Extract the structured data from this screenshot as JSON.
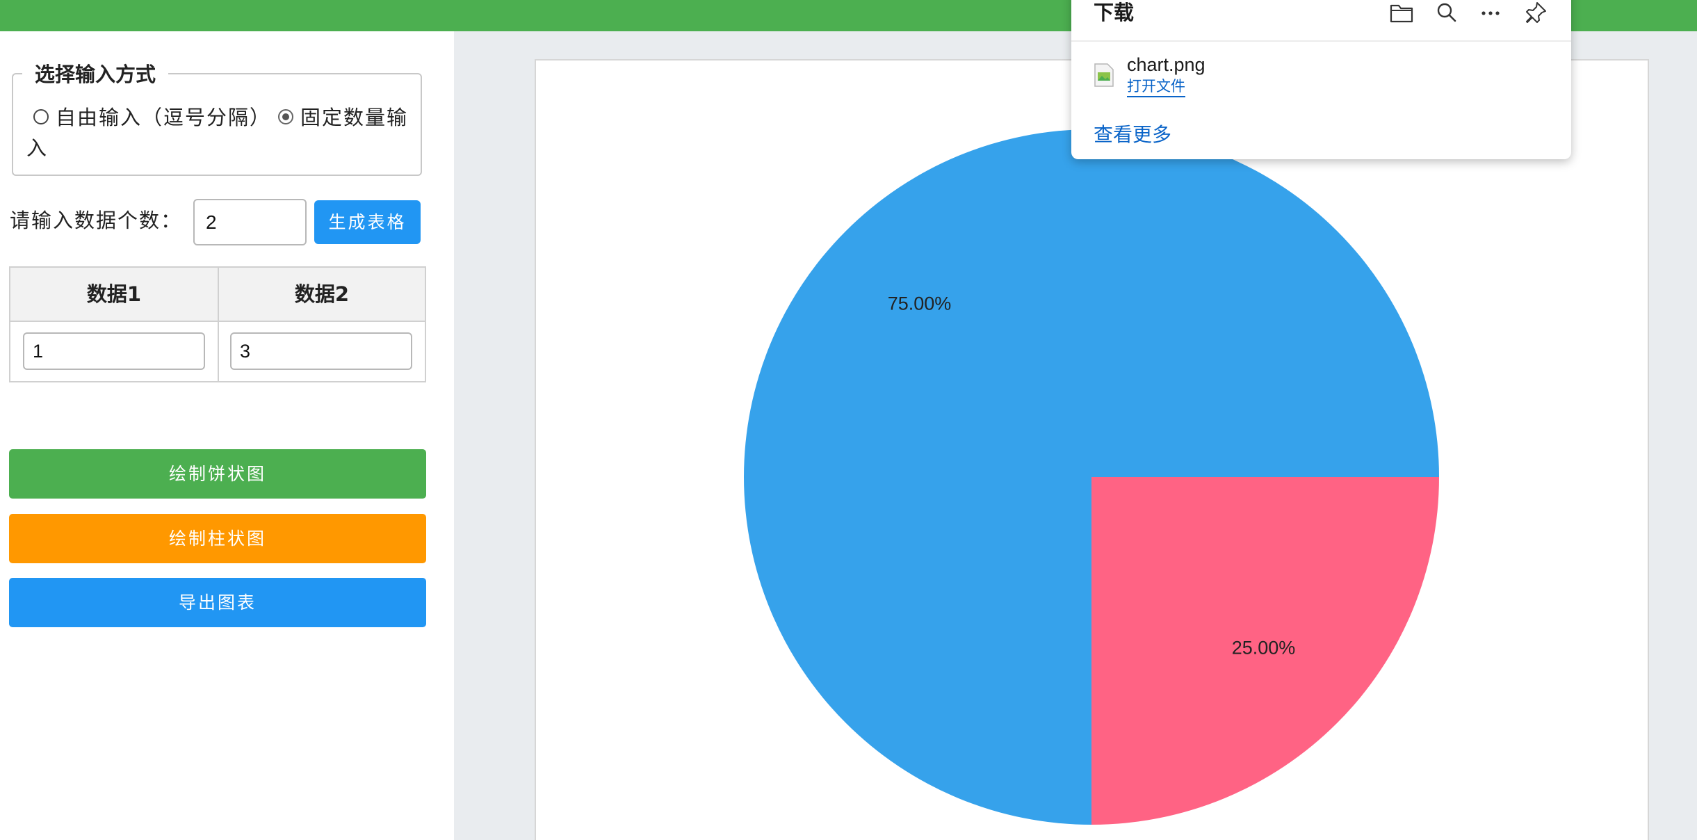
{
  "input_mode": {
    "legend": "选择输入方式",
    "option_free": "自由输入（逗号分隔）",
    "option_fixed": "固定数量输入",
    "selected": "fixed"
  },
  "count": {
    "label": "请输入数据个数：",
    "value": "2",
    "generate_button": "生成表格"
  },
  "table": {
    "headers": [
      "数据1",
      "数据2"
    ],
    "values": [
      "1",
      "3"
    ]
  },
  "actions": {
    "pie_button": "绘制饼状图",
    "bar_button": "绘制柱状图",
    "export_button": "导出图表"
  },
  "colors": {
    "header_green": "#4caf50",
    "pie_button": "#4caf50",
    "bar_button": "#ff9800",
    "export_button": "#2196f3",
    "slice_blue": "#36a2eb",
    "slice_pink": "#ff6384"
  },
  "chart_data": {
    "type": "pie",
    "values": [
      1,
      3
    ],
    "labels": [
      "25.00%",
      "75.00%"
    ],
    "colors": [
      "#ff6384",
      "#36a2eb"
    ]
  },
  "download_popup": {
    "title": "下载",
    "icons": [
      "folder-icon",
      "search-icon",
      "more-icon",
      "pin-icon"
    ],
    "file_name": "chart.png",
    "open_file": "打开文件",
    "see_more": "查看更多"
  }
}
